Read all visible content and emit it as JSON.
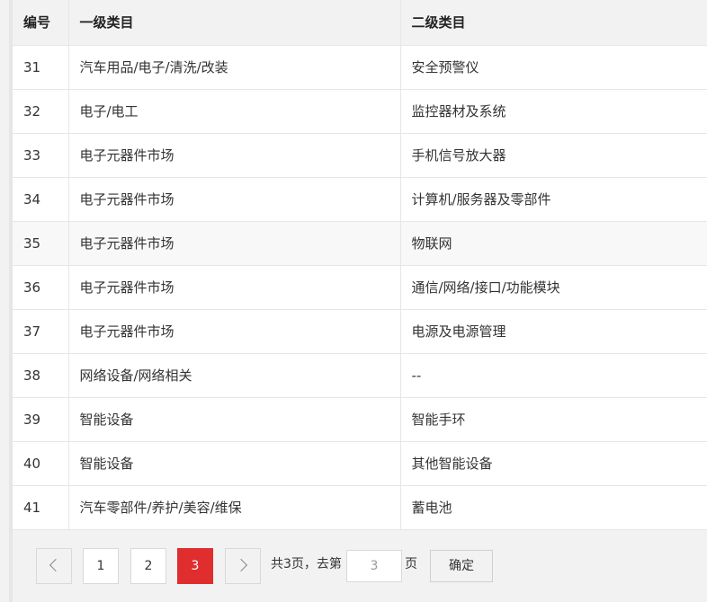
{
  "table": {
    "headers": [
      "编号",
      "一级类目",
      "二级类目"
    ],
    "rows": [
      {
        "id": "31",
        "level1": "汽车用品/电子/清洗/改装",
        "level2": "安全预警仪"
      },
      {
        "id": "32",
        "level1": "电子/电工",
        "level2": "监控器材及系统"
      },
      {
        "id": "33",
        "level1": "电子元器件市场",
        "level2": "手机信号放大器"
      },
      {
        "id": "34",
        "level1": "电子元器件市场",
        "level2": "计算机/服务器及零部件"
      },
      {
        "id": "35",
        "level1": "电子元器件市场",
        "level2": "物联网"
      },
      {
        "id": "36",
        "level1": "电子元器件市场",
        "level2": "通信/网络/接口/功能模块"
      },
      {
        "id": "37",
        "level1": "电子元器件市场",
        "level2": "电源及电源管理"
      },
      {
        "id": "38",
        "level1": "网络设备/网络相关",
        "level2": "--"
      },
      {
        "id": "39",
        "level1": "智能设备",
        "level2": "智能手环"
      },
      {
        "id": "40",
        "level1": "智能设备",
        "level2": "其他智能设备"
      },
      {
        "id": "41",
        "level1": "汽车零部件/养护/美容/维保",
        "level2": "蓄电池"
      }
    ]
  },
  "pagination": {
    "prev_icon": "chevron-left-icon",
    "next_icon": "chevron-right-icon",
    "pages": [
      "1",
      "2",
      "3"
    ],
    "current_page": "3",
    "total_text": "共3页，去第",
    "goto_value": "3",
    "page_suffix": "页",
    "confirm_label": "确定",
    "active_color": "#e02d2d"
  }
}
